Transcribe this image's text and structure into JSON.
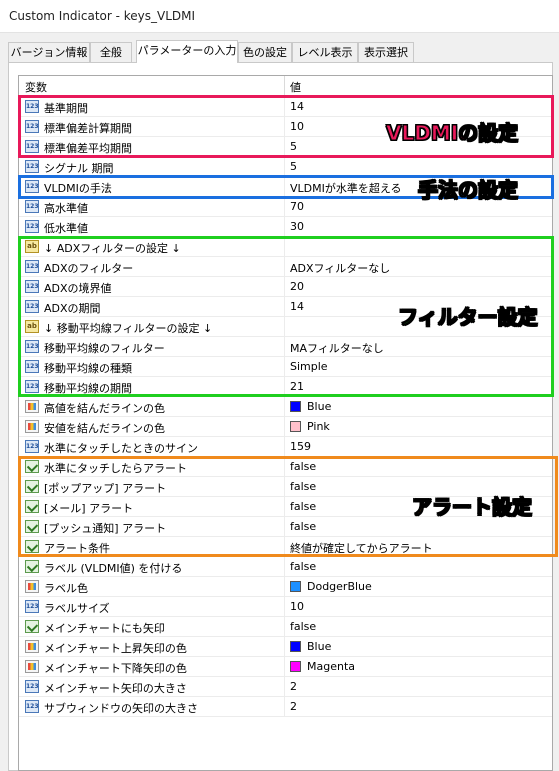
{
  "window": {
    "title": "Custom Indicator - keys_VLDMI"
  },
  "tabs": [
    {
      "label": "バージョン情報"
    },
    {
      "label": "全般"
    },
    {
      "label": "パラメーターの入力"
    },
    {
      "label": "色の設定"
    },
    {
      "label": "レベル表示"
    },
    {
      "label": "表示選択"
    }
  ],
  "active_tab": "パラメーターの入力",
  "grid": {
    "headers": {
      "name": "変数",
      "value": "値"
    },
    "rows": [
      {
        "icon": "number-icon",
        "name": "基準期間",
        "value": "14"
      },
      {
        "icon": "number-icon",
        "name": "標準偏差計算期間",
        "value": "10"
      },
      {
        "icon": "number-icon",
        "name": "標準偏差平均期間",
        "value": "5"
      },
      {
        "icon": "number-icon",
        "name": "シグナル 期間",
        "value": "5"
      },
      {
        "icon": "number-icon",
        "name": "VLDMIの手法",
        "value": "VLDMIが水準を超える"
      },
      {
        "icon": "number-icon",
        "name": "高水準値",
        "value": "70"
      },
      {
        "icon": "number-icon",
        "name": "低水準値",
        "value": "30"
      },
      {
        "icon": "string-icon",
        "name": "↓ ADXフィルターの設定 ↓",
        "value": ""
      },
      {
        "icon": "number-icon",
        "name": "ADXのフィルター",
        "value": "ADXフィルターなし"
      },
      {
        "icon": "number-icon",
        "name": "ADXの境界値",
        "value": "20"
      },
      {
        "icon": "number-icon",
        "name": "ADXの期間",
        "value": "14"
      },
      {
        "icon": "string-icon",
        "name": "↓ 移動平均線フィルターの設定 ↓",
        "value": ""
      },
      {
        "icon": "number-icon",
        "name": "移動平均線のフィルター",
        "value": "MAフィルターなし"
      },
      {
        "icon": "number-icon",
        "name": "移動平均線の種類",
        "value": "Simple"
      },
      {
        "icon": "number-icon",
        "name": "移動平均線の期間",
        "value": "21"
      },
      {
        "icon": "color-icon",
        "name": "高値を結んだラインの色",
        "value": "Blue",
        "swatch": "#0000ff"
      },
      {
        "icon": "color-icon",
        "name": "安値を結んだラインの色",
        "value": "Pink",
        "swatch": "#ffc0cb"
      },
      {
        "icon": "number-icon",
        "name": "水準にタッチしたときのサイン",
        "value": "159"
      },
      {
        "icon": "bool-icon",
        "name": "水準にタッチしたらアラート",
        "value": "false"
      },
      {
        "icon": "bool-icon",
        "name": "[ポップアップ] アラート",
        "value": "false"
      },
      {
        "icon": "bool-icon",
        "name": "[メール] アラート",
        "value": "false"
      },
      {
        "icon": "bool-icon",
        "name": "[プッシュ通知] アラート",
        "value": "false"
      },
      {
        "icon": "bool-icon",
        "name": "アラート条件",
        "value": "終値が確定してからアラート"
      },
      {
        "icon": "bool-icon",
        "name": "ラベル (VLDMI値) を付ける",
        "value": "false"
      },
      {
        "icon": "color-icon",
        "name": "ラベル色",
        "value": "DodgerBlue",
        "swatch": "#1e90ff"
      },
      {
        "icon": "number-icon",
        "name": "ラベルサイズ",
        "value": "10"
      },
      {
        "icon": "bool-icon",
        "name": "メインチャートにも矢印",
        "value": "false"
      },
      {
        "icon": "color-icon",
        "name": "メインチャート上昇矢印の色",
        "value": "Blue",
        "swatch": "#0000ff"
      },
      {
        "icon": "color-icon",
        "name": "メインチャート下降矢印の色",
        "value": "Magenta",
        "swatch": "#ff00ff"
      },
      {
        "icon": "number-icon",
        "name": "メインチャート矢印の大きさ",
        "value": "2"
      },
      {
        "icon": "number-icon",
        "name": "サブウィンドウの矢印の大きさ",
        "value": "2"
      }
    ]
  },
  "annotations": [
    {
      "label": "VLDMIの設定",
      "color": "#e8195a"
    },
    {
      "label": "手法の設定",
      "color": "#1a6fe0"
    },
    {
      "label": "フィルター設定",
      "color": "#1fcf1f"
    },
    {
      "label": "アラート設定",
      "color": "#f08a1c"
    }
  ]
}
